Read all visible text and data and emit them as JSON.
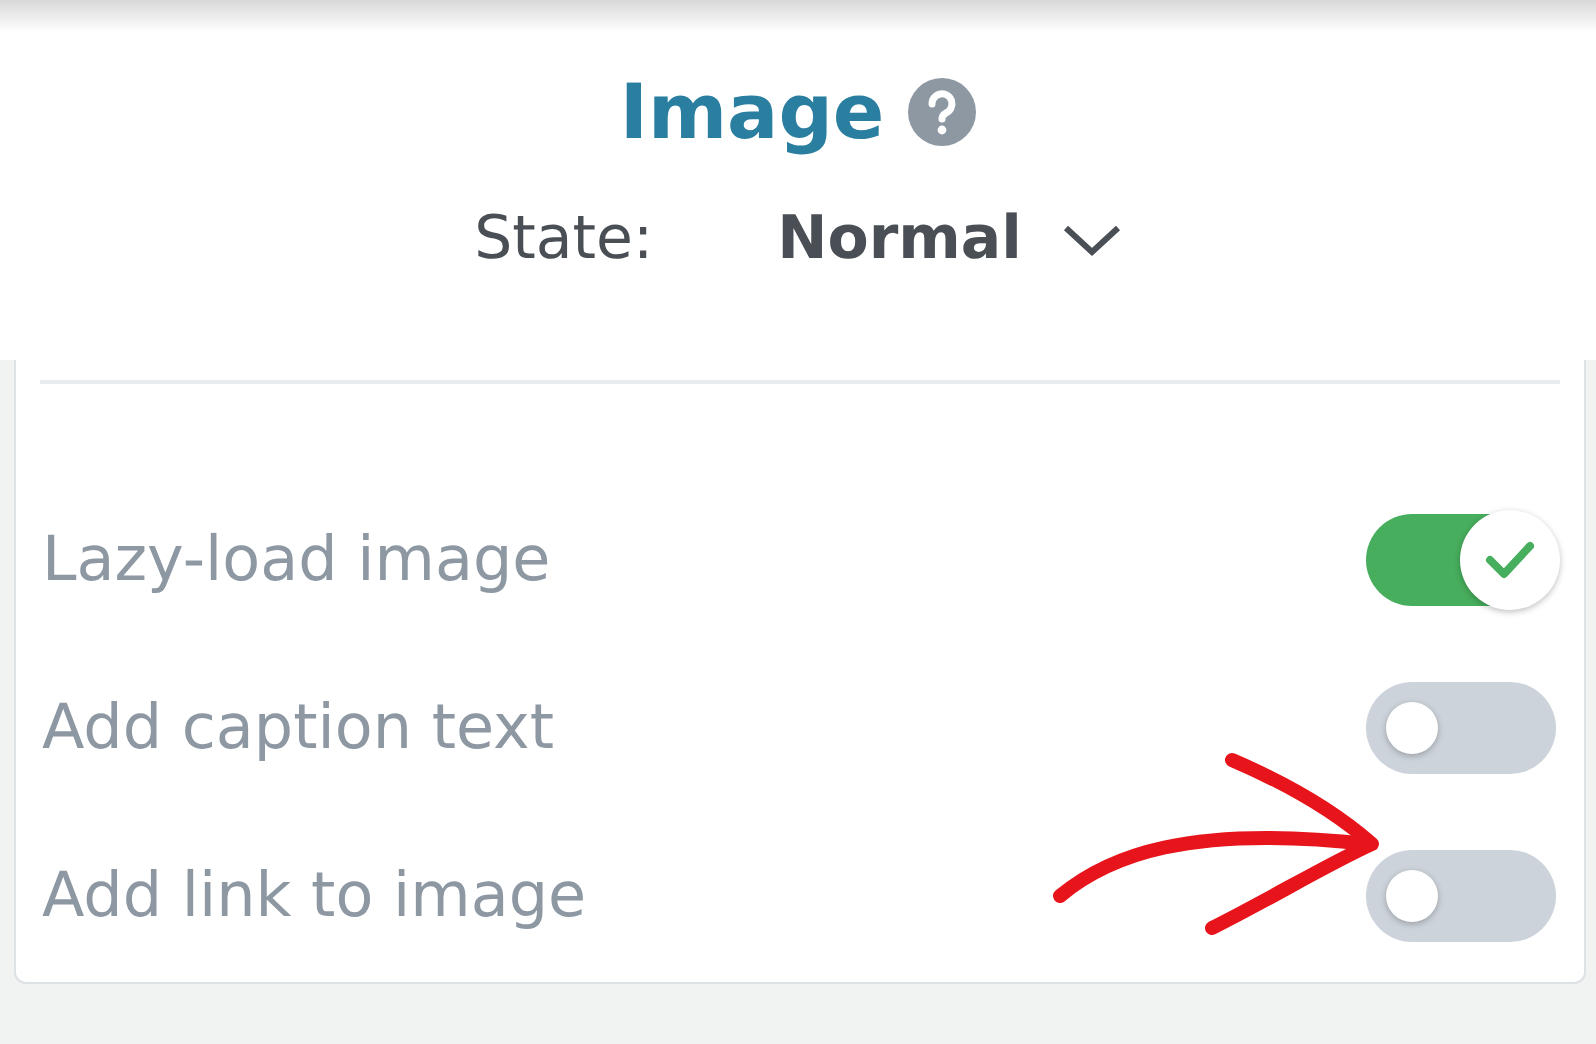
{
  "header": {
    "title": "Image",
    "state_label": "State:",
    "state_value": "Normal"
  },
  "options": [
    {
      "label": "Lazy-load image",
      "on": true
    },
    {
      "label": "Add caption text",
      "on": false
    },
    {
      "label": "Add link to image",
      "on": false
    }
  ]
}
